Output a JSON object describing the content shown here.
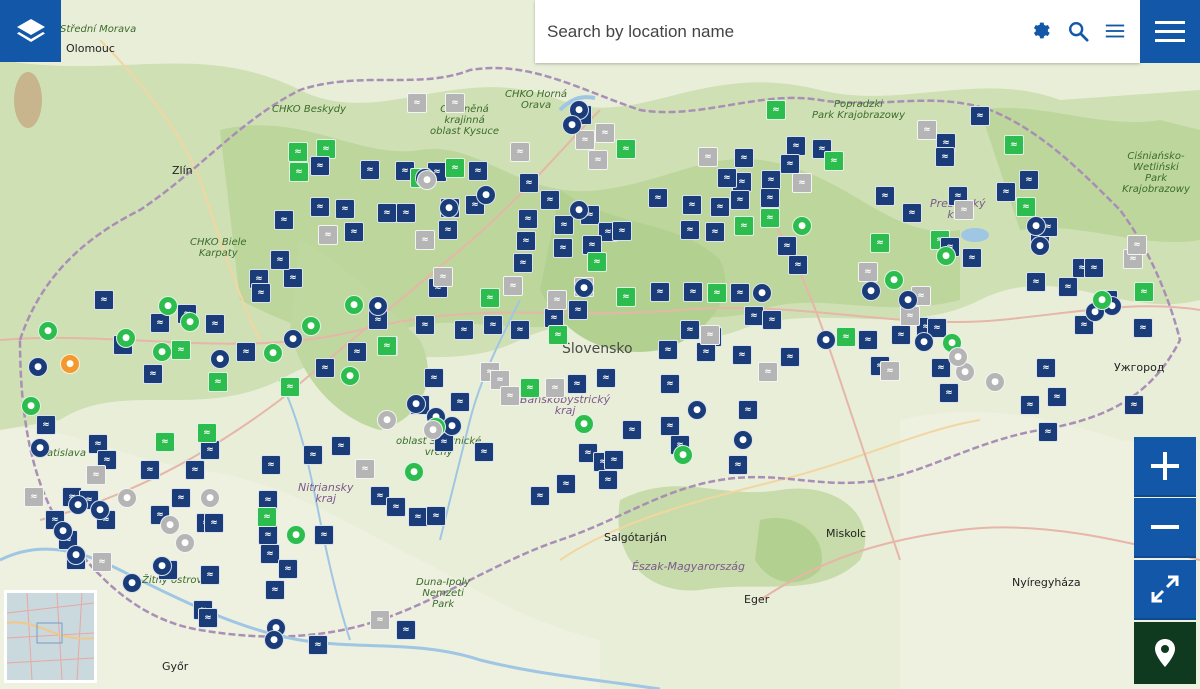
{
  "search": {
    "placeholder": "Search by location name"
  },
  "controls": {
    "layers_icon": "layers-icon",
    "settings_icon": "gear-icon",
    "search_icon": "search-icon",
    "list_icon": "list-icon",
    "menu_icon": "hamburger-menu-icon",
    "zoom_in_icon": "plus-icon",
    "zoom_out_icon": "minus-icon",
    "fullscreen_icon": "expand-icon",
    "locate_icon": "location-pin-icon"
  },
  "colors": {
    "primary_blue": "#1358a8",
    "marker_navy": "#1a3d7a",
    "marker_green": "#2dbd4e",
    "marker_grey": "#b5b5b5",
    "marker_orange": "#f29a2e",
    "locate_dark": "#0f3a20"
  },
  "map_labels": [
    {
      "text": "Střední Morava"
    },
    {
      "text": "Olomouc"
    },
    {
      "text": "CHKO Beskydy"
    },
    {
      "text": "Chráněná\nkrajinná\noblast Kysuce"
    },
    {
      "text": "CHKO Horná\nOrava"
    },
    {
      "text": "Popradzki\nPark Krajobrazowy"
    },
    {
      "text": "Ciśniańsko-\nWetliński\nPark Krajobrazowy"
    },
    {
      "text": "Zlín"
    },
    {
      "text": "CHKO Biele\nKarpaty"
    },
    {
      "text": "Slovensko"
    },
    {
      "text": "Banskobystrický\nkraj"
    },
    {
      "text": "Nitriansky\nkraj"
    },
    {
      "text": "Ужгород"
    },
    {
      "text": "Salgótarján"
    },
    {
      "text": "Észak-Magyarország"
    },
    {
      "text": "Miskolc"
    },
    {
      "text": "Duna-Ipoly\nNemzeti\nPark"
    },
    {
      "text": "Eger"
    },
    {
      "text": "Nyíregyháza"
    },
    {
      "text": "Győr"
    },
    {
      "text": "Žitný ostrov"
    },
    {
      "text": "Bratislava"
    },
    {
      "text": "oblasť Štiavnické\nvrchy"
    },
    {
      "text": "Prešovský\nkraj"
    }
  ]
}
